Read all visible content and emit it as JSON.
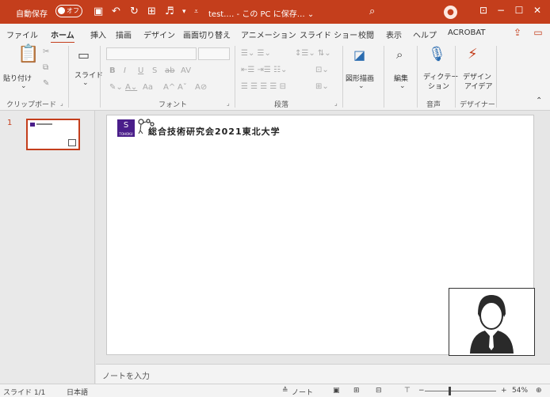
{
  "titlebar": {
    "autosave_label": "自動保存",
    "autosave_state": "オフ",
    "document_title": "test.… - この PC に保存… ⌄",
    "icons": [
      "save-icon",
      "undo-icon",
      "redo-icon",
      "present-icon",
      "customize-icon",
      "search-icon",
      "account-icon",
      "ribbon-display-icon",
      "minimize-icon",
      "maximize-icon",
      "close-icon"
    ]
  },
  "tabs": [
    "ファイル",
    "ホーム",
    "挿入",
    "描画",
    "デザイン",
    "画面切り替え",
    "アニメーション",
    "スライド ショー",
    "校閲",
    "表示",
    "ヘルプ",
    "ACROBAT"
  ],
  "active_tab": "ホーム",
  "ribbon": {
    "clipboard": {
      "label": "クリップボード",
      "paste": "貼り付け"
    },
    "slides": {
      "new_slide": "スライド"
    },
    "font": {
      "label": "フォント",
      "bold": "B",
      "italic": "I",
      "underline": "U",
      "shadow": "S",
      "strike": "ab",
      "spacing": "AV",
      "case": "Aa",
      "grow": "A^",
      "shrink": "Aˇ"
    },
    "paragraph": {
      "label": "段落"
    },
    "drawing": {
      "label": "図形描画"
    },
    "editing": {
      "label": "編集"
    },
    "voice": {
      "label": "音声",
      "dictate_line1": "ディクテー",
      "dictate_line2": "ション"
    },
    "designer": {
      "label": "デザイナー",
      "ideas_line1": "デザイン",
      "ideas_line2": "アイデア"
    }
  },
  "slide_pane": {
    "slide_number": "1"
  },
  "slide": {
    "logo_text": "S",
    "logo_sub": "TOHOKU",
    "title": "総合技術研究会2021東北大学"
  },
  "notes": {
    "placeholder": "ノートを入力"
  },
  "status": {
    "slide_info": "スライド 1/1",
    "language": "日本語",
    "notes_button": "ノート",
    "zoom_minus": "−",
    "zoom_plus": "+",
    "zoom_level": "54%"
  },
  "colors": {
    "accent": "#c43e1c",
    "logo": "#4a1e8a"
  }
}
